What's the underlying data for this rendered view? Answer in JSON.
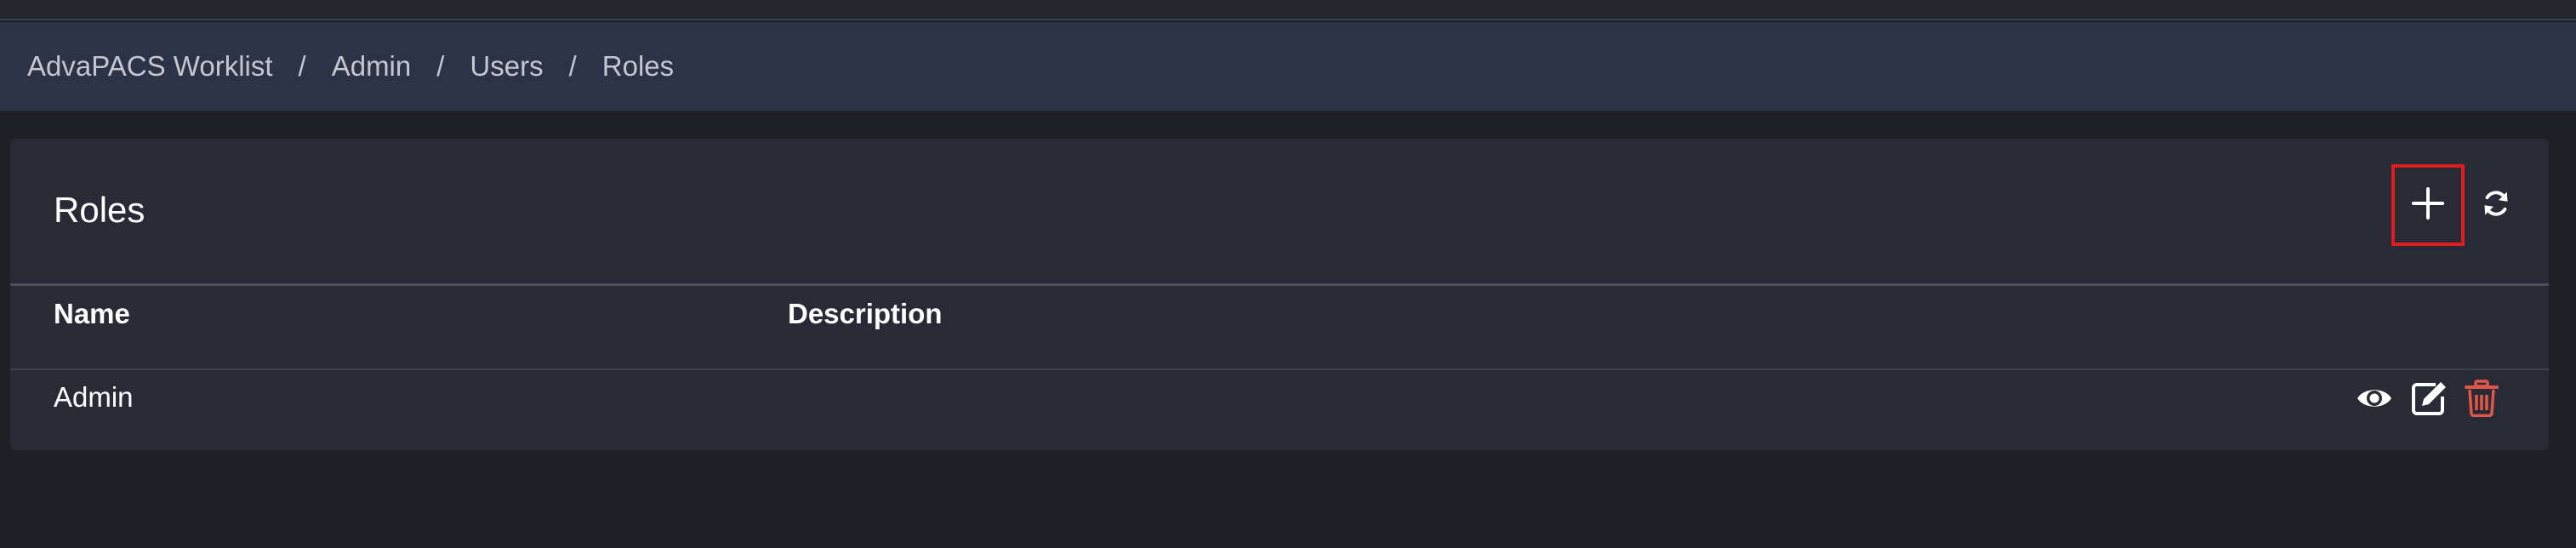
{
  "breadcrumb": {
    "items": [
      "AdvaPACS Worklist",
      "Admin",
      "Users",
      "Roles"
    ],
    "separator": "/"
  },
  "panel": {
    "title": "Roles",
    "add_icon": "plus-icon",
    "refresh_icon": "refresh-icon"
  },
  "table": {
    "columns": [
      "Name",
      "Description"
    ],
    "rows": [
      {
        "name": "Admin",
        "description": "",
        "actions": [
          "eye-icon",
          "edit-icon",
          "trash-icon"
        ]
      }
    ]
  },
  "colors": {
    "accent_highlight": "#e01c1c",
    "delete": "#e0574a",
    "breadcrumb_bg": "#2d3347",
    "panel_bg": "#282b35"
  }
}
